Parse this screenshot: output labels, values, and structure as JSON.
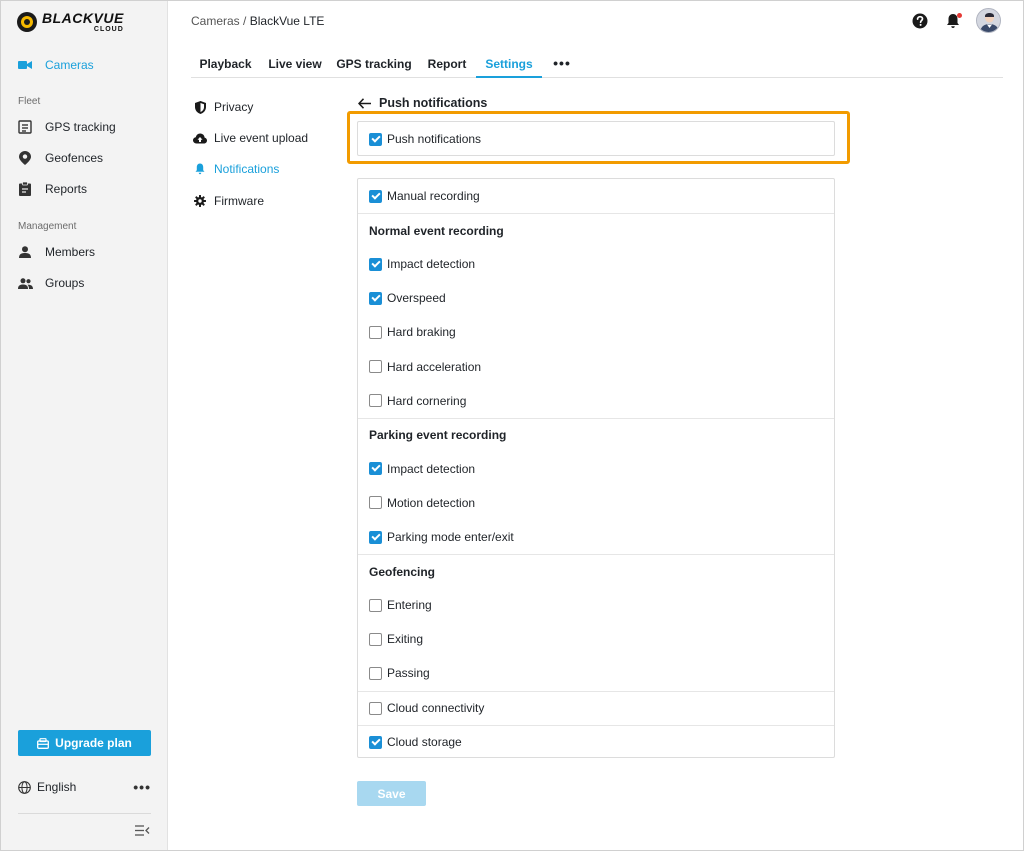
{
  "brand": {
    "name": "BLACKVUE",
    "sub": "CLOUD"
  },
  "sidebar": {
    "primary": {
      "label": "Cameras",
      "icon": "camera-icon"
    },
    "sections": [
      {
        "label": "Fleet",
        "items": [
          {
            "label": "GPS tracking",
            "icon": "gps-list-icon"
          },
          {
            "label": "Geofences",
            "icon": "location-pin-icon"
          },
          {
            "label": "Reports",
            "icon": "clipboard-icon"
          }
        ]
      },
      {
        "label": "Management",
        "items": [
          {
            "label": "Members",
            "icon": "person-icon"
          },
          {
            "label": "Groups",
            "icon": "group-icon"
          }
        ]
      }
    ],
    "upgrade_label": "Upgrade plan",
    "language": "English"
  },
  "header": {
    "breadcrumb_root": "Cameras",
    "breadcrumb_sep": "/",
    "breadcrumb_current": "BlackVue LTE"
  },
  "tabs": [
    {
      "label": "Playback",
      "active": false
    },
    {
      "label": "Live view",
      "active": false
    },
    {
      "label": "GPS tracking",
      "active": false
    },
    {
      "label": "Report",
      "active": false
    },
    {
      "label": "Settings",
      "active": true
    }
  ],
  "tabs_more": "•••",
  "settings_menu": [
    {
      "label": "Privacy",
      "icon": "shield-icon",
      "active": false
    },
    {
      "label": "Live event upload",
      "icon": "cloud-upload-icon",
      "active": false
    },
    {
      "label": "Notifications",
      "icon": "bell-icon",
      "active": true
    },
    {
      "label": "Firmware",
      "icon": "gear-icon",
      "active": false
    }
  ],
  "panel": {
    "title": "Push notifications",
    "master": {
      "label": "Push notifications",
      "checked": true
    },
    "rows": [
      {
        "type": "check",
        "label": "Manual recording",
        "checked": true
      },
      {
        "type": "heading",
        "label": "Normal event recording"
      },
      {
        "type": "check",
        "label": "Impact detection",
        "checked": true
      },
      {
        "type": "check",
        "label": "Overspeed",
        "checked": true
      },
      {
        "type": "check",
        "label": "Hard braking",
        "checked": false
      },
      {
        "type": "check",
        "label": "Hard acceleration",
        "checked": false
      },
      {
        "type": "check",
        "label": "Hard cornering",
        "checked": false
      },
      {
        "type": "heading",
        "label": "Parking event recording"
      },
      {
        "type": "check",
        "label": "Impact detection",
        "checked": true
      },
      {
        "type": "check",
        "label": "Motion detection",
        "checked": false
      },
      {
        "type": "check",
        "label": "Parking mode enter/exit",
        "checked": true
      },
      {
        "type": "heading",
        "label": "Geofencing"
      },
      {
        "type": "check",
        "label": "Entering",
        "checked": false
      },
      {
        "type": "check",
        "label": "Exiting",
        "checked": false
      },
      {
        "type": "check",
        "label": "Passing",
        "checked": false
      },
      {
        "type": "check",
        "label": "Cloud connectivity",
        "checked": false
      },
      {
        "type": "check",
        "label": "Cloud storage",
        "checked": true
      }
    ],
    "save_label": "Save"
  },
  "colors": {
    "accent": "#1aa0db",
    "highlight": "#f29b00",
    "checkbox": "#1a8fd6"
  }
}
